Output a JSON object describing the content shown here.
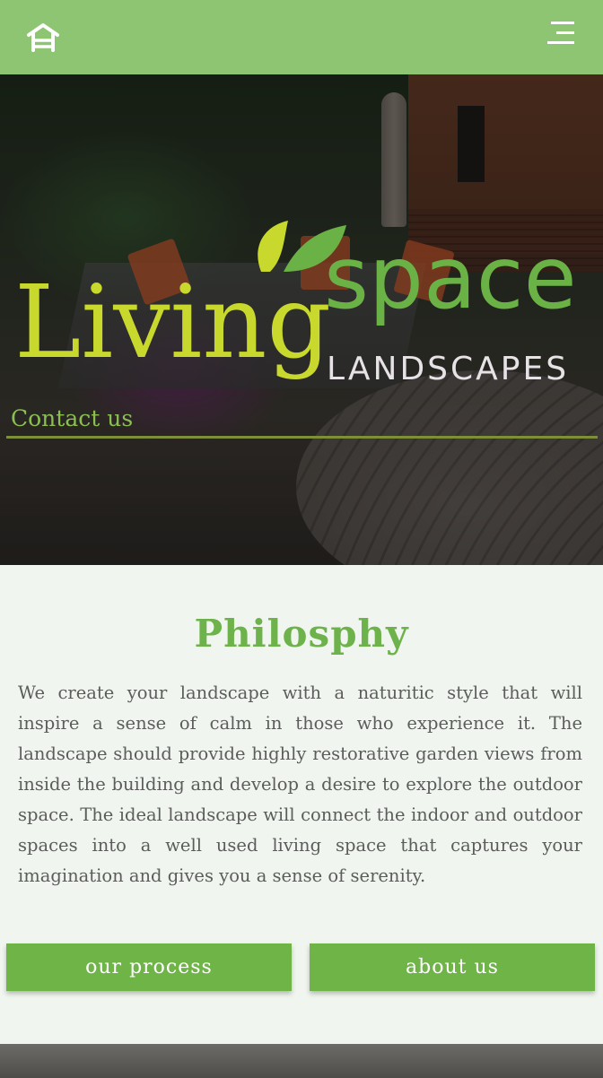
{
  "header": {
    "home_icon": "home-icon",
    "menu_icon": "hamburger-menu-icon",
    "bar_color": "#8dc572"
  },
  "hero": {
    "logo": {
      "word_living": "Living",
      "word_space": "space",
      "word_landscapes": "LANDSCAPES",
      "living_color": "#c8d82c",
      "space_color": "#6ab245"
    },
    "contact_label": "Contact us"
  },
  "philosophy": {
    "title": "Philosphy",
    "body": "We create your landscape with a naturitic style that will inspire a sense of calm in those who experience it. The landscape should provide highly restorative garden views from inside the building and develop a desire to explore the outdoor space. The ideal landscape will connect the indoor and outdoor spaces into a well used living space that captures your imagination and gives you a sense of serenity."
  },
  "buttons": {
    "process_label": "our process",
    "about_label": "about us",
    "color": "#6fb447"
  }
}
